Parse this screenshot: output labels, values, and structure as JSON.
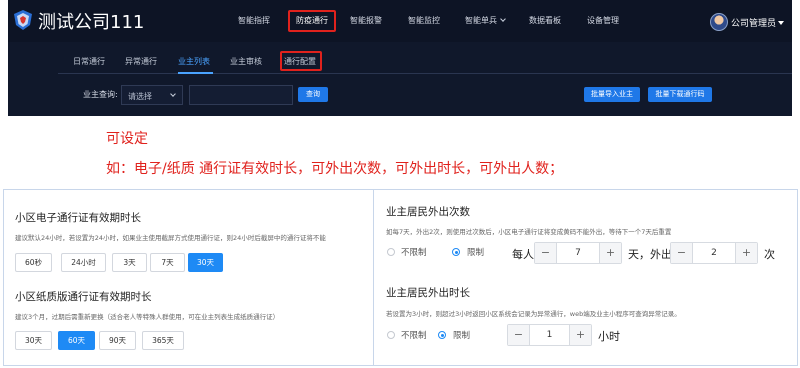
{
  "app": {
    "brand": "测试公司111",
    "nav": [
      "智能指挥",
      "防疫通行",
      "智能报警",
      "智能监控",
      "智能单兵",
      "数据看板",
      "设备管理"
    ],
    "user": "公司管理员",
    "subnav": [
      "日常通行",
      "异常通行",
      "业主列表",
      "业主审核",
      "通行配置"
    ],
    "search": {
      "label": "业主查询:",
      "select_value": "请选择",
      "input_value": "",
      "search_button": "查询",
      "import_button": "批量导入业主",
      "download_button": "批量下载通行码"
    }
  },
  "annotation": {
    "line1": "可设定",
    "line2": "如：电子/纸质 通行证有效时长，可外出次数，可外出时长，可外出人数；"
  },
  "left_panel": {
    "electronic": {
      "title": "小区电子通行证有效期时长",
      "desc": "建议默认24小时，若设置为24小时，如果业主使用截屏方式使用通行证，则24小时后截屏中的通行证将不能",
      "options": [
        "60秒",
        "24小时",
        "3天",
        "7天",
        "30天"
      ],
      "selected": "30天"
    },
    "paper": {
      "title": "小区纸质版通行证有效期时长",
      "desc": "建议3个月，过期后需重新更换（适合老人等特殊人群使用，可在业主列表生成纸质通行证）",
      "options": [
        "30天",
        "60天",
        "90天",
        "365天"
      ],
      "selected": "60天"
    }
  },
  "right_panel": {
    "count": {
      "title": "业主居民外出次数",
      "desc": "如每7天，外出2次，则使用过次数后，小区电子通行证将变成黄码不能外出，等待下一个7天后重置",
      "radio_unlimited": "不限制",
      "radio_limited": "限制",
      "label_each": "每人",
      "days_value": "7",
      "label_days_out": "天，外出",
      "times_value": "2",
      "label_times": "次"
    },
    "duration": {
      "title": "业主居民外出时长",
      "desc": "若设置为3小时，则超过3小时返回小区系统会记录为异常通行，web端及业主小程序可查询异常记录。",
      "radio_unlimited": "不限制",
      "radio_limited": "限制",
      "hours_value": "1",
      "label_hours": "小时"
    }
  },
  "colors": {
    "accent": "#1e8af5",
    "highlight_red": "#e0221d",
    "app_bg": "#10182b"
  }
}
